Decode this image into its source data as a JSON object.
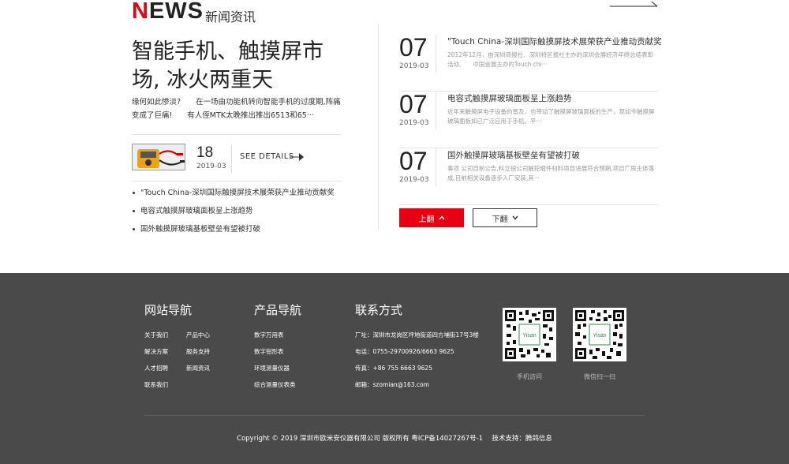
{
  "header": {
    "logo_first": "N",
    "logo_rest": "EWS",
    "subtitle": "新闻资讯"
  },
  "feature": {
    "headline": "智能手机、触摸屏市场, 冰火两重天",
    "summary": "缘何如此惨淡?　　在一场由功能机转向智能手机的过度期,阵痛变成了巨痛!　　有人侄MTK太晚推出推出6513和65···",
    "day": "18",
    "year_month": "2019-03",
    "see_details": "SEE DETAILS"
  },
  "side_list": [
    "\"Touch China-深圳国际触摸屏技术展荣获产业推动贡献奖",
    "电容式触摸屏玻璃面板呈上涨趋势",
    "国外触摸屏玻璃基板壁垒有望被打破"
  ],
  "news": [
    {
      "day": "07",
      "year_month": "2019-03",
      "title": "\"Touch China-深圳国际触摸屏技术展荣获产业推动贡献奖",
      "desc": "2012年12月，由深圳商报社、深圳特区报社主办的深圳会展经济年终总结表彰活动,　　中国会展主办的Touch chi···"
    },
    {
      "day": "07",
      "year_month": "2019-03",
      "title": "电容式触摸屏玻璃面板呈上涨趋势",
      "desc": "近年来触摸屏电子设备的普及，也带动了触摸屏玻璃面板的生产，现如今触摸屏玻璃面板如已广泛应用于手机、平···"
    },
    {
      "day": "07",
      "year_month": "2019-03",
      "title": "国外触摸屏玻璃基板壁垒有望被打破",
      "desc": "事项 公司目前公告,科立锐公司触控细件材料项目进展符合预期,项目厂房主体落成,目前相关设备逐步入厂安装,其···"
    }
  ],
  "pager": {
    "prev": "上翻",
    "next": "下翻"
  },
  "footer": {
    "site_nav": {
      "title": "网站导航",
      "links": [
        "关于我们",
        "产品中心",
        "解决方案",
        "服务支持",
        "人才招聘",
        "新闻资讯",
        "联系我们"
      ]
    },
    "product_nav": {
      "title": "产品导航",
      "links": [
        "数字万用表",
        "数字钳形表",
        "环境测量仪器",
        "综合测量仪表类"
      ]
    },
    "contact": {
      "title": "联系方式",
      "lines": [
        "厂址：深圳市龙岗区坪地街道四方埔街17号3楼",
        "电话：0755-29700926/6663 9625",
        "传真：+86 755 6663 9625",
        "邮箱：szomian@163.com"
      ]
    },
    "qr": [
      {
        "label": "Yisan",
        "caption": "手机访问"
      },
      {
        "label": "Yisan",
        "caption": "微信扫一扫"
      }
    ],
    "copyright": "Copyright © 2019 深圳市欧米安仪器有限公司 版权所有 粤ICP备14027267号-1　 技术支持：腾鸽信息"
  },
  "colors": {
    "accent": "#e60012",
    "footer_bg": "#4a4a4a"
  }
}
